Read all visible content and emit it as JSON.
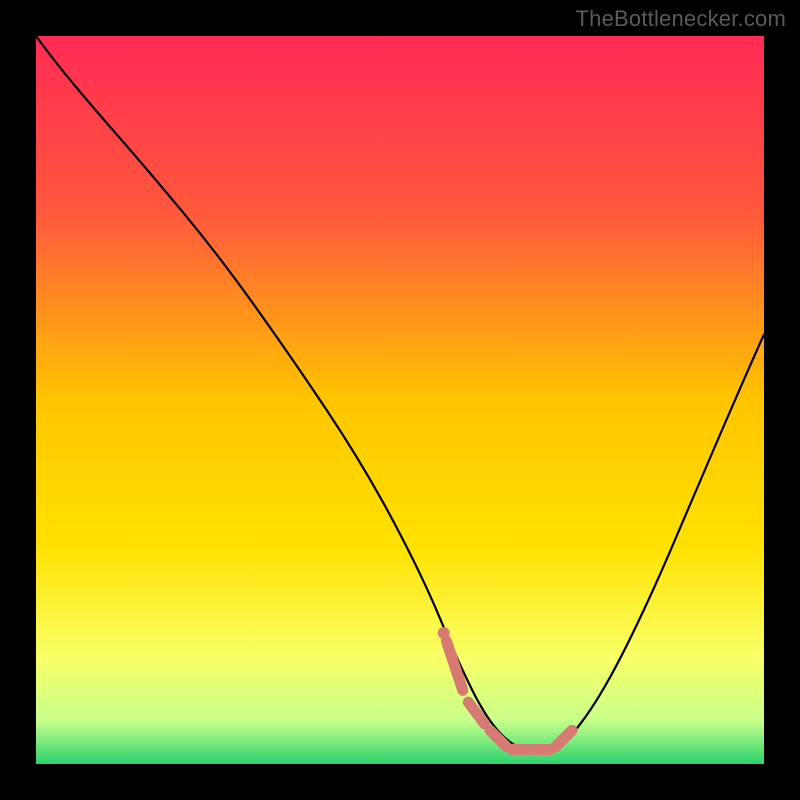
{
  "watermark": "TheBottlenecker.com",
  "chart_data": {
    "type": "line",
    "title": "",
    "xlabel": "",
    "ylabel": "",
    "xlim": [
      0,
      100
    ],
    "ylim": [
      0,
      100
    ],
    "grid": false,
    "legend": false,
    "background_gradient": {
      "stops": [
        {
          "offset": 0,
          "color": "#ff2a55"
        },
        {
          "offset": 25,
          "color": "#ff5a3c"
        },
        {
          "offset": 50,
          "color": "#ffc500"
        },
        {
          "offset": 70,
          "color": "#ffe100"
        },
        {
          "offset": 85,
          "color": "#faff66"
        },
        {
          "offset": 94,
          "color": "#c8ff8a"
        },
        {
          "offset": 100,
          "color": "#2bd36e"
        }
      ]
    },
    "series": [
      {
        "name": "bottleneck-curve",
        "color": "#000000",
        "x": [
          0,
          3,
          8,
          15,
          25,
          35,
          45,
          53,
          58,
          62,
          66,
          70,
          73,
          78,
          84,
          90,
          96,
          100
        ],
        "y": [
          100,
          96,
          90,
          82,
          70,
          56,
          41,
          26,
          14,
          6,
          2,
          1.5,
          3,
          10,
          22,
          36,
          50,
          59
        ]
      }
    ],
    "highlight": {
      "name": "optimal-range",
      "color": "#d77a74",
      "points_x": [
        56,
        59,
        62,
        65,
        68,
        71,
        74
      ],
      "points_y": [
        18,
        9,
        5,
        2,
        2,
        2,
        5
      ],
      "dot_x": 56,
      "dot_y": 18
    }
  }
}
